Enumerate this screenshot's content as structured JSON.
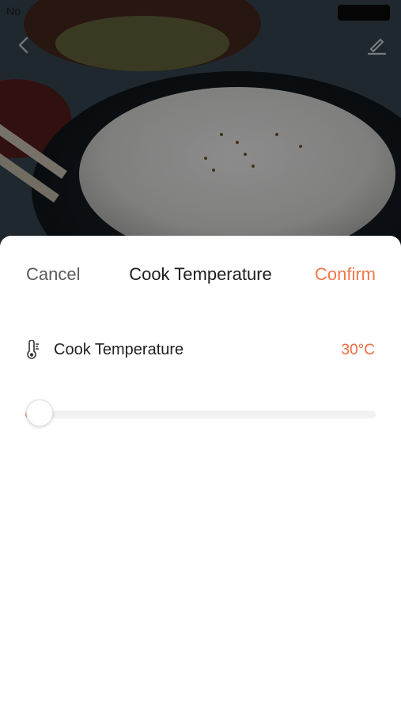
{
  "status_bar": {
    "carrier": "No"
  },
  "nav": {
    "back_icon": "chevron-left-icon",
    "edit_icon": "pencil-icon"
  },
  "sheet": {
    "cancel_label": "Cancel",
    "title": "Cook Temperature",
    "confirm_label": "Confirm",
    "row": {
      "icon": "thermometer-icon",
      "label": "Cook Temperature",
      "value": "30°C"
    },
    "slider": {
      "fraction": 0.04
    }
  },
  "colors": {
    "accent": "#f0784a",
    "value_text": "#ee6a3c",
    "track": "#f2f2f2"
  }
}
